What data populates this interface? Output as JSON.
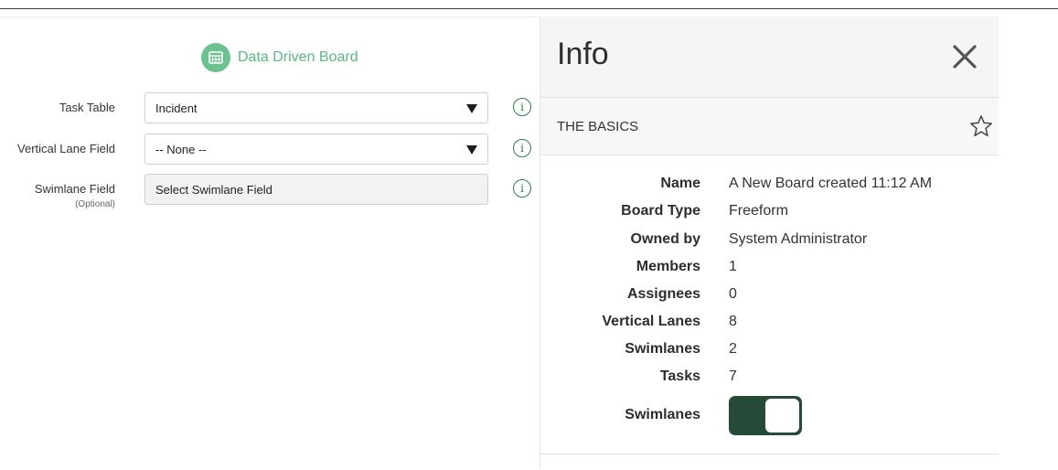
{
  "board": {
    "title": "Data Driven Board",
    "icon": "board-grid-icon",
    "accent_color": "#6bc28f"
  },
  "form": {
    "task_table": {
      "label": "Task Table",
      "value": "Incident",
      "info_icon": "info-icon"
    },
    "vertical_lane_field": {
      "label": "Vertical Lane Field",
      "value": "-- None --",
      "info_icon": "info-icon"
    },
    "swimlane_field": {
      "label": "Swimlane Field",
      "sublabel": "(Optional)",
      "placeholder": "Select Swimlane Field",
      "info_icon": "info-icon"
    }
  },
  "info_panel": {
    "title": "Info",
    "close_icon": "close-icon",
    "section": {
      "title": "THE BASICS",
      "star_icon": "star-outline-icon"
    },
    "details": [
      {
        "key": "Name",
        "value": "A New Board created 11:12 AM"
      },
      {
        "key": "Board Type",
        "value": "Freeform"
      },
      {
        "key": "Owned by",
        "value": "System Administrator"
      },
      {
        "key": "Members",
        "value": "1"
      },
      {
        "key": "Assignees",
        "value": "0"
      },
      {
        "key": "Vertical Lanes",
        "value": "8"
      },
      {
        "key": "Swimlanes",
        "value": "2"
      },
      {
        "key": "Tasks",
        "value": "7"
      }
    ],
    "swimlanes_toggle": {
      "label": "Swimlanes",
      "state": "on",
      "color": "#254b38"
    }
  }
}
